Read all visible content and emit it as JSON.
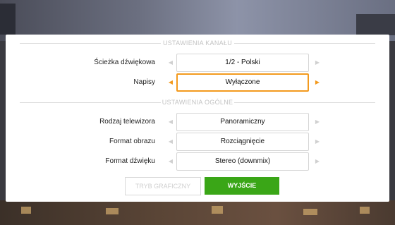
{
  "channel_section": {
    "title": "USTAWIENIA KANAŁU"
  },
  "general_section": {
    "title": "USTAWIENIA OGÓLNE"
  },
  "settings": [
    {
      "label": "Ścieżka dźwiękowa",
      "value": "1/2 - Polski"
    },
    {
      "label": "Napisy",
      "value": "Wyłączone"
    },
    {
      "label": "Rodzaj telewizora",
      "value": "Panoramiczny"
    },
    {
      "label": "Format obrazu",
      "value": "Rozciągnięcie"
    },
    {
      "label": "Format dźwięku",
      "value": "Stereo (downmix)"
    }
  ],
  "buttons": {
    "mode_label": "TRYB GRAFICZNY",
    "exit_label": "WYJŚCIE"
  },
  "icons": {
    "left": "◀",
    "right": "▶"
  },
  "colors": {
    "accent": "#f39a1e",
    "exit": "#3aa617"
  }
}
